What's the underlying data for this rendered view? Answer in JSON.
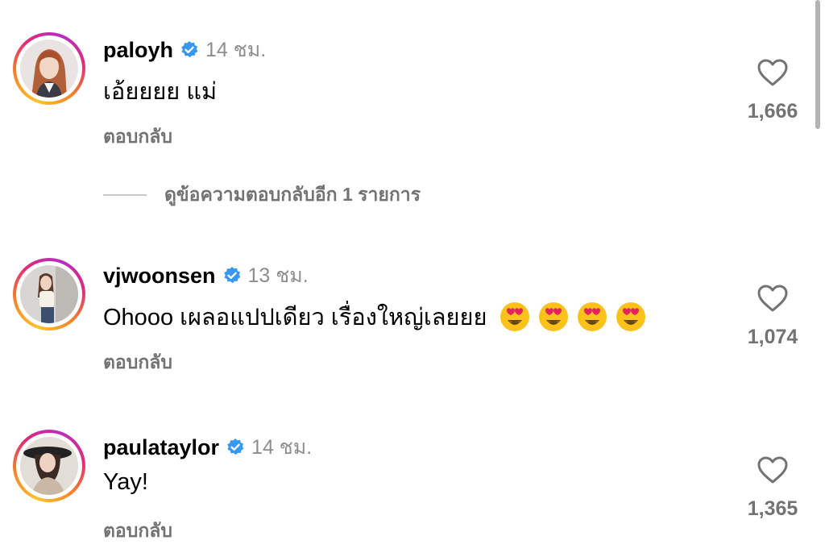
{
  "colors": {
    "verified": "#3897f0",
    "muted": "#737373",
    "time": "#8e8e8e"
  },
  "comments": [
    {
      "username": "paloyh",
      "time": "14 ชม.",
      "text": "เอ้ยยยย แม่",
      "reply": "ตอบกลับ",
      "likes": "1,666",
      "view_replies": "ดูข้อความตอบกลับอีก 1 รายการ"
    },
    {
      "username": "vjwoonsen",
      "time": "13 ชม.",
      "text": "Ohooo เผลอแปปเดียว เรื่องใหญ่เลยยย",
      "emoji": [
        "heart-eyes-emoji",
        "heart-eyes-emoji",
        "heart-eyes-emoji",
        "heart-eyes-emoji"
      ],
      "reply": "ตอบกลับ",
      "likes": "1,074"
    },
    {
      "username": "paulataylor",
      "time": "14 ชม.",
      "text": "Yay!",
      "reply": "ตอบกลับ",
      "likes": "1,365"
    }
  ]
}
